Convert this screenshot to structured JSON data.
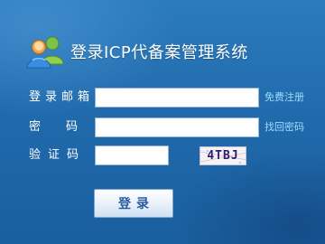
{
  "header": {
    "title": "登录ICP代备案管理系统",
    "icon": "users-icon"
  },
  "form": {
    "email_label": "登录邮箱",
    "email_value": "",
    "password_label": "密码",
    "password_value": "",
    "captcha_label": "验证码",
    "captcha_value": "",
    "captcha_code": "4TBJ"
  },
  "links": {
    "register": "免费注册",
    "forgot_password": "找回密码"
  },
  "actions": {
    "login_label": "登录"
  },
  "colors": {
    "background": "#1f6aa5",
    "link": "#9fdcff",
    "button_text": "#2a5aa0"
  }
}
